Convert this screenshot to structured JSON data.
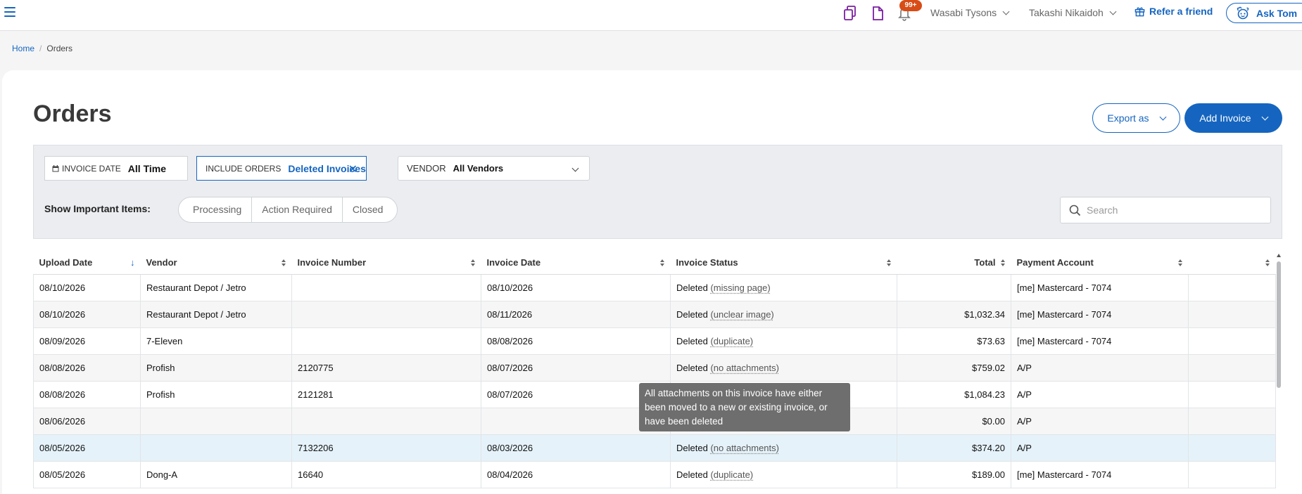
{
  "topbar": {
    "notification_count": "99+",
    "location": "Wasabi Tysons",
    "user": "Takashi Nikaidoh",
    "refer_label": "Refer a friend",
    "ask_label": "Ask Tom"
  },
  "breadcrumb": {
    "home": "Home",
    "current": "Orders"
  },
  "page": {
    "title": "Orders",
    "export_label": "Export as",
    "add_label": "Add Invoice"
  },
  "filters": {
    "invoice_date_label": "INVOICE DATE",
    "invoice_date_value": "All Time",
    "include_label": "INCLUDE ORDERS",
    "include_value": "Deleted Invoices",
    "vendor_label": "VENDOR",
    "vendor_value": "All Vendors",
    "important_label": "Show Important Items:",
    "important_options": [
      "Processing",
      "Action Required",
      "Closed"
    ],
    "search_placeholder": "Search"
  },
  "table": {
    "columns": [
      "Upload Date",
      "Vendor",
      "Invoice Number",
      "Invoice Date",
      "Invoice Status",
      "Total",
      "Payment Account",
      ""
    ],
    "rows": [
      {
        "upload": "08/10/2026",
        "vendor": "Restaurant Depot / Jetro",
        "number": "",
        "date": "08/10/2026",
        "status": "Deleted",
        "reason": "(missing page)",
        "total": "",
        "account": "[me] Mastercard - 7074"
      },
      {
        "upload": "08/10/2026",
        "vendor": "Restaurant Depot / Jetro",
        "number": "",
        "date": "08/11/2026",
        "status": "Deleted",
        "reason": "(unclear image)",
        "total": "$1,032.34",
        "account": "[me] Mastercard - 7074"
      },
      {
        "upload": "08/09/2026",
        "vendor": "7-Eleven",
        "number": "",
        "date": "08/08/2026",
        "status": "Deleted",
        "reason": "(duplicate)",
        "total": "$73.63",
        "account": "[me] Mastercard - 7074"
      },
      {
        "upload": "08/08/2026",
        "vendor": "Profish",
        "number": "2120775",
        "date": "08/07/2026",
        "status": "Deleted",
        "reason": "(no attachments)",
        "total": "$759.02",
        "account": "A/P"
      },
      {
        "upload": "08/08/2026",
        "vendor": "Profish",
        "number": "2121281",
        "date": "08/07/2026",
        "status": "",
        "reason": "",
        "total": "$1,084.23",
        "account": "A/P"
      },
      {
        "upload": "08/06/2026",
        "vendor": "",
        "number": "",
        "date": "",
        "status": "",
        "reason": "",
        "total": "$0.00",
        "account": "A/P"
      },
      {
        "upload": "08/05/2026",
        "vendor": "",
        "number": "7132206",
        "date": "08/03/2026",
        "status": "Deleted",
        "reason": "(no attachments)",
        "total": "$374.20",
        "account": "A/P"
      },
      {
        "upload": "08/05/2026",
        "vendor": "Dong-A",
        "number": "16640",
        "date": "08/04/2026",
        "status": "Deleted",
        "reason": "(duplicate)",
        "total": "$189.00",
        "account": "[me] Mastercard - 7074"
      }
    ]
  },
  "tooltip": {
    "text": "All attachments on this invoice have either been moved to a new or existing invoice, or have been deleted"
  }
}
